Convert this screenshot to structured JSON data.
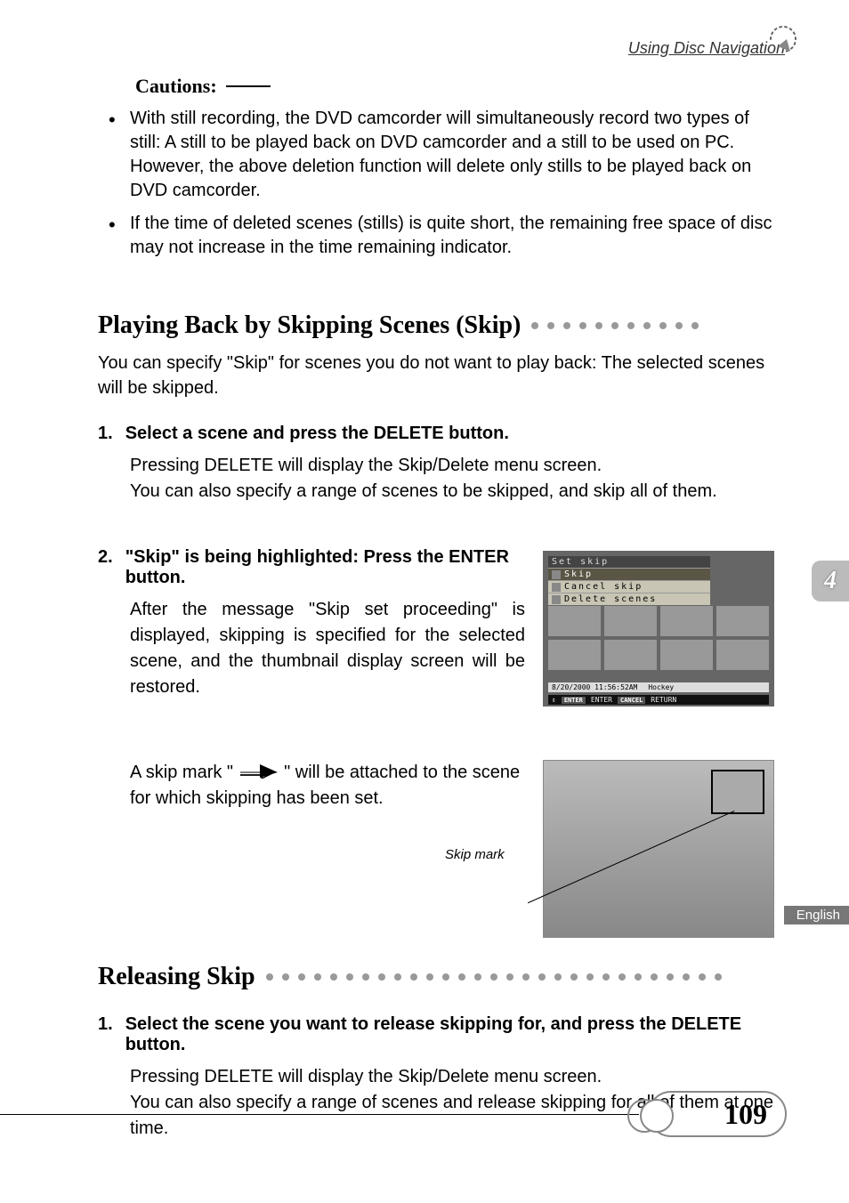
{
  "header": {
    "section": "Using Disc Navigation"
  },
  "cautions": {
    "title": "Cautions:",
    "items": [
      "With still recording, the DVD camcorder will simultaneously record two types of still: A still to be played back on DVD camcorder and a still to be used on PC. However, the above deletion function will delete only stills to be played back on DVD camcorder.",
      "If the time of deleted scenes (stills) is quite short, the remaining free space of disc may not increase in the time remaining indicator."
    ]
  },
  "section_skip": {
    "title": "Playing Back by Skipping Scenes (Skip)",
    "intro": "You can specify \"Skip\" for scenes you do not want to play back: The selected scenes will be skipped.",
    "step1": {
      "num": "1.",
      "title": "Select a scene and press the DELETE button.",
      "body1": "Pressing DELETE will display the Skip/Delete menu screen.",
      "body2": "You can also specify a range of scenes to be skipped, and skip all of them."
    },
    "step2": {
      "num": "2.",
      "title": "\"Skip\" is being highlighted: Press the ENTER button.",
      "body": "After the message \"Skip set proceeding\" is displayed, skipping is specified for the selected scene, and the thumbnail display screen will be restored."
    },
    "skipmark": {
      "pre": "A skip mark \"",
      "post": "\" will be attached to the scene for which skipping has been set.",
      "label": "Skip mark"
    }
  },
  "screenshot": {
    "menu_title": "Set skip",
    "item1": "Skip",
    "item2": "Cancel skip",
    "item3": "Delete scenes",
    "status_date": "8/20/2000 11:56:52AM",
    "status_label": "Hockey",
    "cmd_enter_btn": "ENTER",
    "cmd_enter": "ENTER",
    "cmd_cancel_btn": "CANCEL",
    "cmd_cancel": "RETURN"
  },
  "section_release": {
    "title": "Releasing Skip",
    "step1": {
      "num": "1.",
      "title": "Select the scene you want to release skipping for, and press the DELETE button.",
      "body1": "Pressing DELETE will display the Skip/Delete menu screen.",
      "body2": "You can also specify a range of scenes and release skipping for all of them at one time."
    }
  },
  "chapter": "4",
  "language": "English",
  "page": "109"
}
